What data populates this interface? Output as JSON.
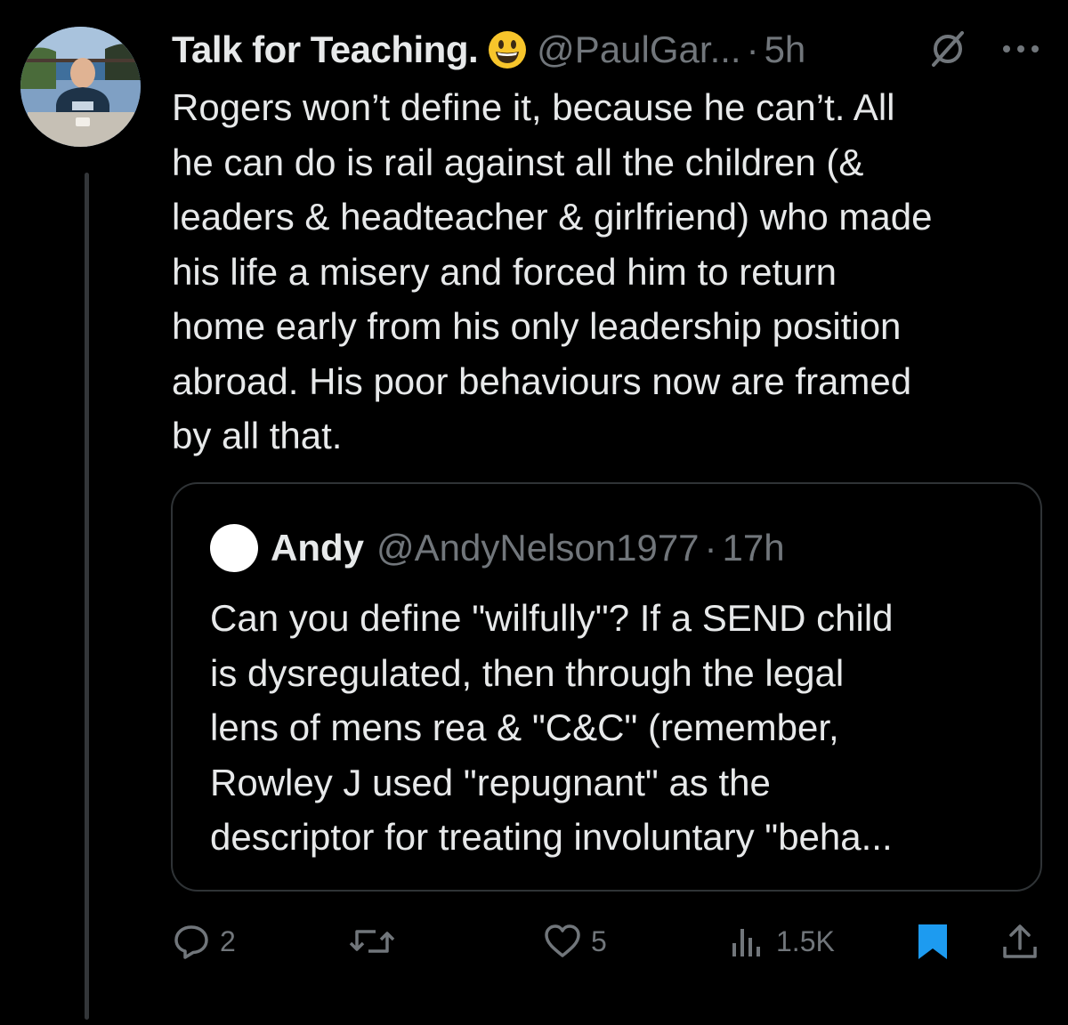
{
  "tweet": {
    "author_name": "Talk for Teaching.",
    "emoji": "grinning-face-emoji",
    "handle": "@PaulGar...",
    "separator": "·",
    "time": "5h",
    "text": "Rogers won’t define it, because he can’t. All\nhe can do is rail against all the children (&\nleaders & headteacher & girlfriend) who made\nhis life a misery and forced him to return\nhome early from his only leadership position\nabroad. His poor behaviours now are framed\nby all that."
  },
  "quoted": {
    "author_name": "Andy",
    "handle": "@AndyNelson1977",
    "separator": "·",
    "time": "17h",
    "text": "Can you define \"wilfully\"? If a SEND child\nis dysregulated, then through the legal\nlens of mens rea & \"C&C\" (remember,\nRowley J used \"repugnant\" as the\ndescriptor for treating involuntary \"beha..."
  },
  "actions": {
    "replies": "2",
    "reposts": "",
    "likes": "5",
    "views": "1.5K"
  },
  "icons": [
    "grok-icon",
    "more-icon",
    "reply-icon",
    "repost-icon",
    "like-icon",
    "views-icon",
    "bookmark-icon",
    "share-icon"
  ],
  "colors": {
    "background": "#000000",
    "text": "#e7e9ea",
    "muted": "#71767b",
    "bookmark": "#1d9bf0",
    "emoji": "#f7c52b"
  }
}
